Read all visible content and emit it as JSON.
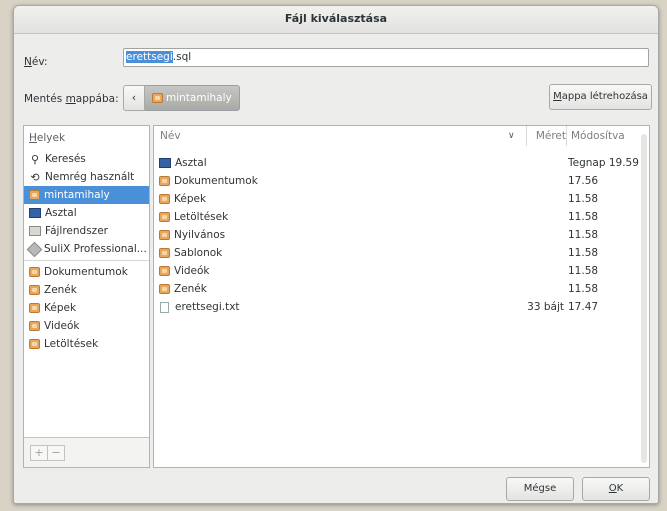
{
  "dialog": {
    "title": "Fájl kiválasztása"
  },
  "name_field": {
    "label_mnemonic": "N",
    "label_rest": "év:",
    "value_selected": "erettsegi",
    "value_rest": ".sql"
  },
  "save_in": {
    "label_before": "Mentés ",
    "label_mnemonic": "m",
    "label_after": "appába:",
    "back_glyph": "‹",
    "current_folder": "mintamihaly"
  },
  "create_folder_button": {
    "mnemonic": "M",
    "rest": "appa létrehozása"
  },
  "places": {
    "title_mnemonic": "H",
    "title_rest": "elyek",
    "items": [
      {
        "label": "Keresés",
        "icon": "search-icon"
      },
      {
        "label": "Nemrég használt",
        "icon": "recent-icon"
      },
      {
        "label": "mintamihaly",
        "icon": "home-folder-icon",
        "selected": true
      },
      {
        "label": "Asztal",
        "icon": "desktop-icon"
      },
      {
        "label": "Fájlrendszer",
        "icon": "filesystem-icon"
      },
      {
        "label": "SuliX Professional...",
        "icon": "disc-icon"
      }
    ],
    "bookmarks": [
      {
        "label": "Dokumentumok",
        "icon": "folder-icon"
      },
      {
        "label": "Zenék",
        "icon": "music-folder-icon"
      },
      {
        "label": "Képek",
        "icon": "pictures-folder-icon"
      },
      {
        "label": "Videók",
        "icon": "videos-folder-icon"
      },
      {
        "label": "Letöltések",
        "icon": "downloads-folder-icon"
      }
    ],
    "add_button": "+",
    "remove_button": "−"
  },
  "file_list": {
    "columns": {
      "name": "Név",
      "size": "Méret",
      "modified": "Módosítva"
    },
    "sort_glyph": "∨",
    "rows": [
      {
        "name": "Asztal",
        "size": "",
        "modified": "Tegnap 19.59",
        "icon": "desktop-icon"
      },
      {
        "name": "Dokumentumok",
        "size": "",
        "modified": "17.56",
        "icon": "folder-icon"
      },
      {
        "name": "Képek",
        "size": "",
        "modified": "11.58",
        "icon": "pictures-folder-icon"
      },
      {
        "name": "Letöltések",
        "size": "",
        "modified": "11.58",
        "icon": "downloads-folder-icon"
      },
      {
        "name": "Nyilvános",
        "size": "",
        "modified": "11.58",
        "icon": "public-folder-icon"
      },
      {
        "name": "Sablonok",
        "size": "",
        "modified": "11.58",
        "icon": "templates-folder-icon"
      },
      {
        "name": "Videók",
        "size": "",
        "modified": "11.58",
        "icon": "videos-folder-icon"
      },
      {
        "name": "Zenék",
        "size": "",
        "modified": "11.58",
        "icon": "music-folder-icon"
      },
      {
        "name": "erettsegi.txt",
        "size": "33 bájt",
        "modified": "17.47",
        "icon": "text-file-icon"
      }
    ]
  },
  "buttons": {
    "cancel": "Mégse",
    "ok_mnemonic": "O",
    "ok_rest": "K"
  }
}
